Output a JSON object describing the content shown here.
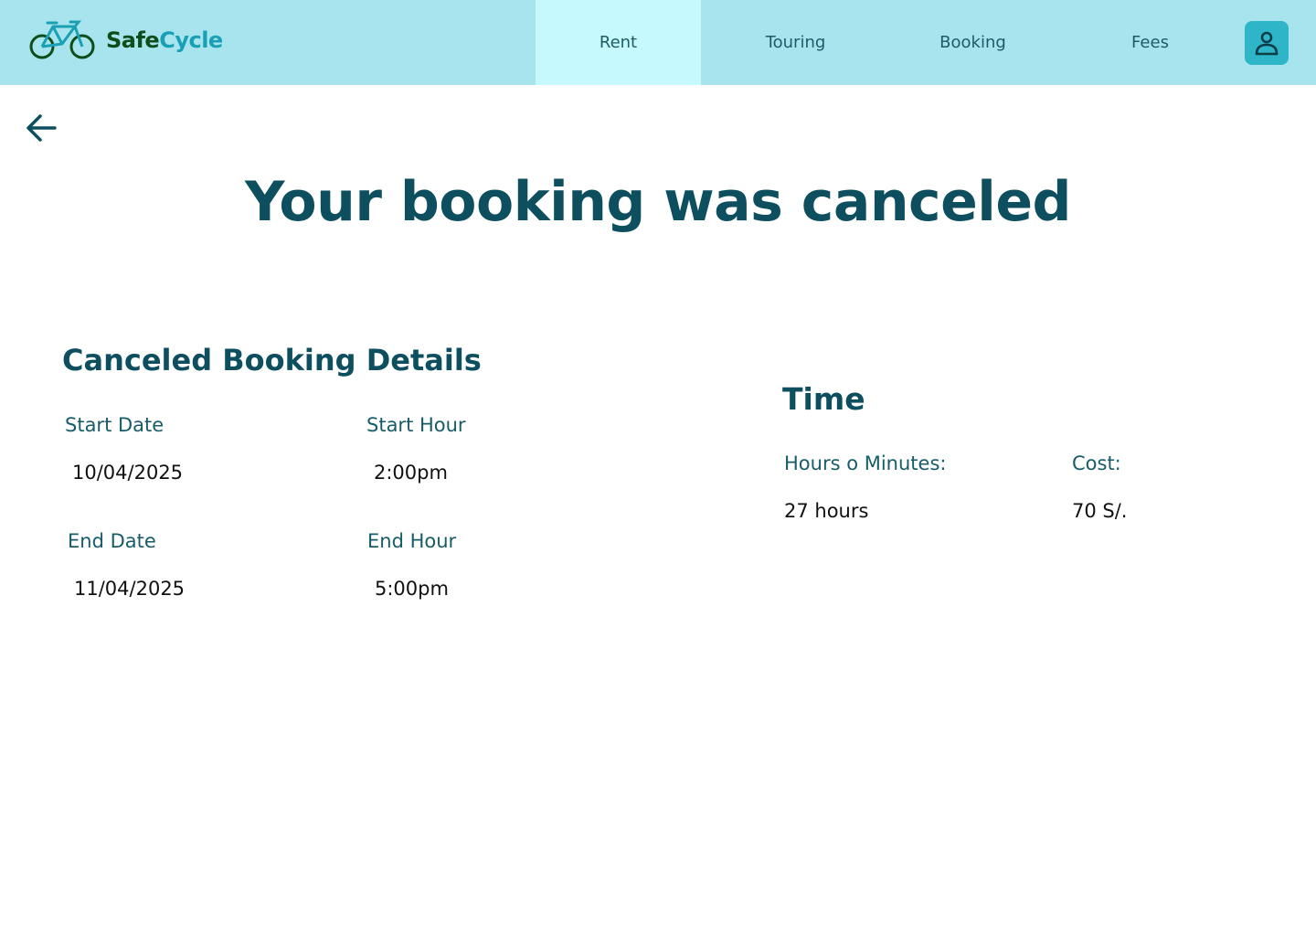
{
  "header": {
    "brand": {
      "part1": "Safe",
      "part2": "Cycle",
      "icon": "bicycle-icon"
    },
    "nav": [
      {
        "label": "Rent",
        "active": true
      },
      {
        "label": "Touring",
        "active": false
      },
      {
        "label": "Booking",
        "active": false
      },
      {
        "label": "Fees",
        "active": false
      }
    ],
    "profile_icon": "user-icon"
  },
  "back_icon": "arrow-left-icon",
  "page_title": "Your booking was canceled",
  "details": {
    "title": "Canceled Booking Details",
    "start_date_label": "Start Date",
    "start_date_value": "10/04/2025",
    "start_hour_label": "Start Hour",
    "start_hour_value": "2:00pm",
    "end_date_label": "End Date",
    "end_date_value": "11/04/2025",
    "end_hour_label": "End Hour",
    "end_hour_value": "5:00pm"
  },
  "time": {
    "title": "Time",
    "duration_label": "Hours o Minutes:",
    "duration_value": "27 hours",
    "cost_label": "Cost:",
    "cost_value": "70 S/."
  },
  "colors": {
    "header_bg": "#a8e4ee",
    "active_tab_bg": "#c5f9fd",
    "primary_text": "#0d4f5e",
    "profile_bg": "#2fb5c8"
  }
}
